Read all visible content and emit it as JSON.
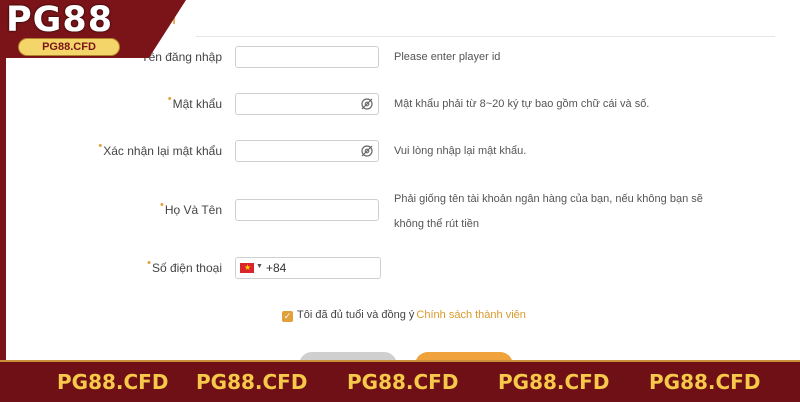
{
  "header": {
    "title_fragment": "n",
    "logo_text": "PG88",
    "logo_url": "PG88.CFD"
  },
  "form": {
    "username": {
      "label": "Tên đăng nhập",
      "value": "",
      "hint": "Please enter player id"
    },
    "password": {
      "label": "Mật khẩu",
      "value": "",
      "hint": "Mật khẩu phải từ 8~20 ký tự bao gồm chữ cái và số.",
      "icon": "eye-slash-icon"
    },
    "confirm_password": {
      "label": "Xác nhận lại mật khẩu",
      "value": "",
      "hint": "Vui lòng nhập lại mật khẩu.",
      "icon": "eye-slash-icon"
    },
    "fullname": {
      "label": "Họ Và Tên",
      "value": "",
      "hint_line1": "Phải giống tên tài khoản ngân hàng của bạn, nếu không bạn sẽ",
      "hint_line2": "không thể rút tiền"
    },
    "phone": {
      "label": "Số điện thoại",
      "country_code": "+84",
      "flag": "vietnam-flag-icon"
    },
    "agree": {
      "text": "Tôi đã đủ tuổi và đồng ý",
      "link": "Chính sách thành viên",
      "checked": true
    }
  },
  "banner": {
    "items": [
      "PG88.CFD",
      "PG88.CFD",
      "PG88.CFD",
      "PG88.CFD",
      "PG88.CFD"
    ]
  },
  "colors": {
    "accent": "#e0a03a",
    "brand": "#7a1418",
    "banner_text": "#f6c94a"
  }
}
